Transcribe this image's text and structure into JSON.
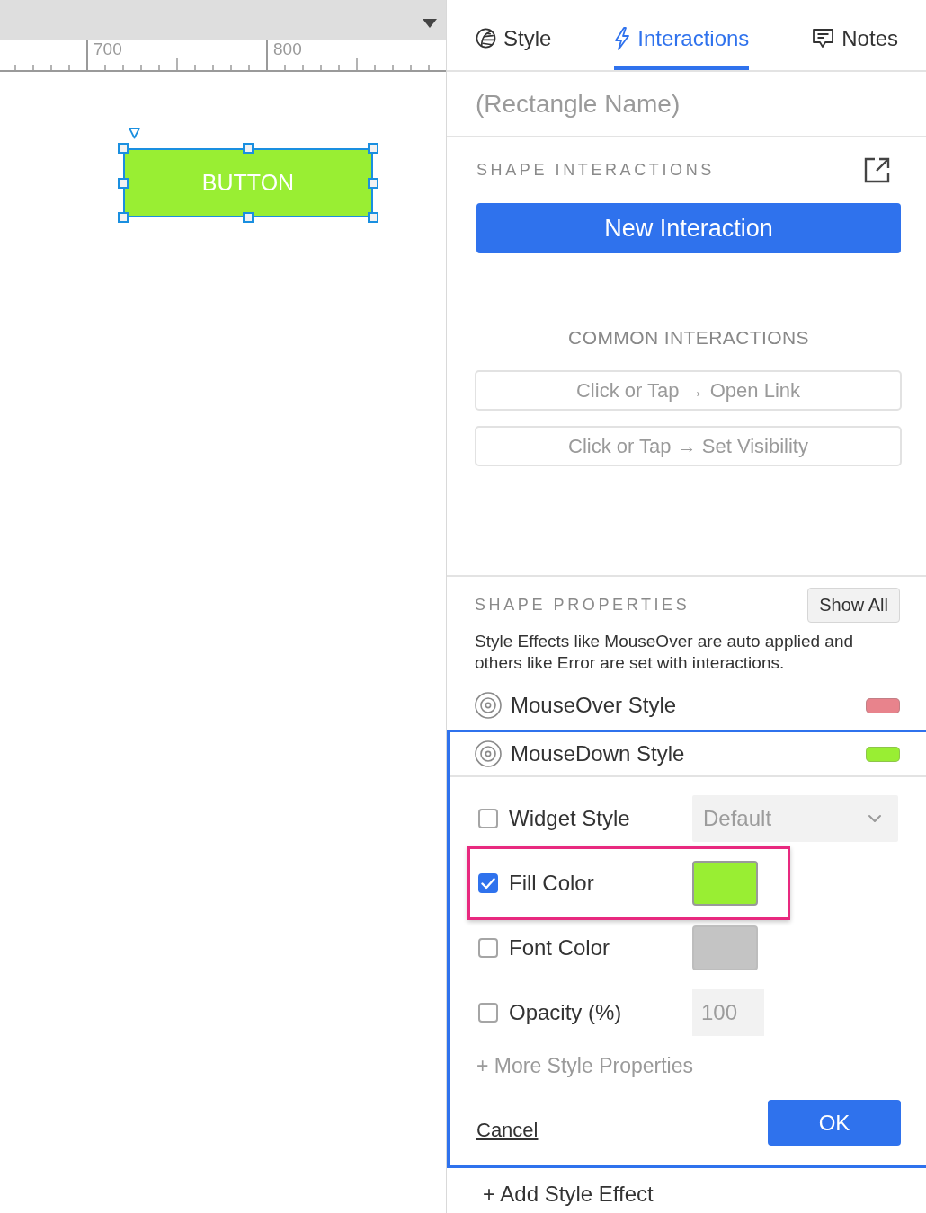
{
  "ruler": {
    "labels": [
      "700",
      "800"
    ]
  },
  "canvas": {
    "widget": {
      "label": "BUTTON",
      "selected": true
    }
  },
  "panel": {
    "tabs": [
      {
        "label": "Style",
        "selected": false
      },
      {
        "label": "Interactions",
        "selected": true
      },
      {
        "label": "Notes",
        "selected": false
      }
    ],
    "name_field": {
      "placeholder": "(Rectangle Name)"
    },
    "shape_interactions": {
      "heading": "SHAPE INTERACTIONS",
      "new_button": "New Interaction",
      "common_heading": "COMMON INTERACTIONS",
      "common": [
        "Click or Tap → Open Link",
        "Click or Tap → Set Visibility"
      ]
    },
    "shape_properties": {
      "heading": "SHAPE PROPERTIES",
      "show_all": "Show All",
      "description": "Style Effects like MouseOver are auto applied and others like Error are set with interactions.",
      "effects": [
        {
          "label": "MouseOver Style",
          "color": "#e8838c",
          "expanded": false
        },
        {
          "label": "MouseDown Style",
          "color": "#99ee33",
          "expanded": true,
          "editor": {
            "properties": [
              {
                "kind": "select",
                "label": "Widget Style",
                "checked": false,
                "highlighted": false,
                "value": "Default"
              },
              {
                "kind": "color",
                "label": "Fill Color",
                "checked": true,
                "highlighted": true,
                "color": "#99ee33"
              },
              {
                "kind": "color",
                "label": "Font Color",
                "checked": false,
                "highlighted": false,
                "color": "#c4c4c4"
              },
              {
                "kind": "number",
                "label": "Opacity (%)",
                "checked": false,
                "highlighted": false,
                "value": "100"
              }
            ],
            "more_link": "+ More Style Properties",
            "cancel": "Cancel",
            "ok": "OK"
          }
        }
      ],
      "add_effect": "+ Add Style Effect"
    }
  }
}
